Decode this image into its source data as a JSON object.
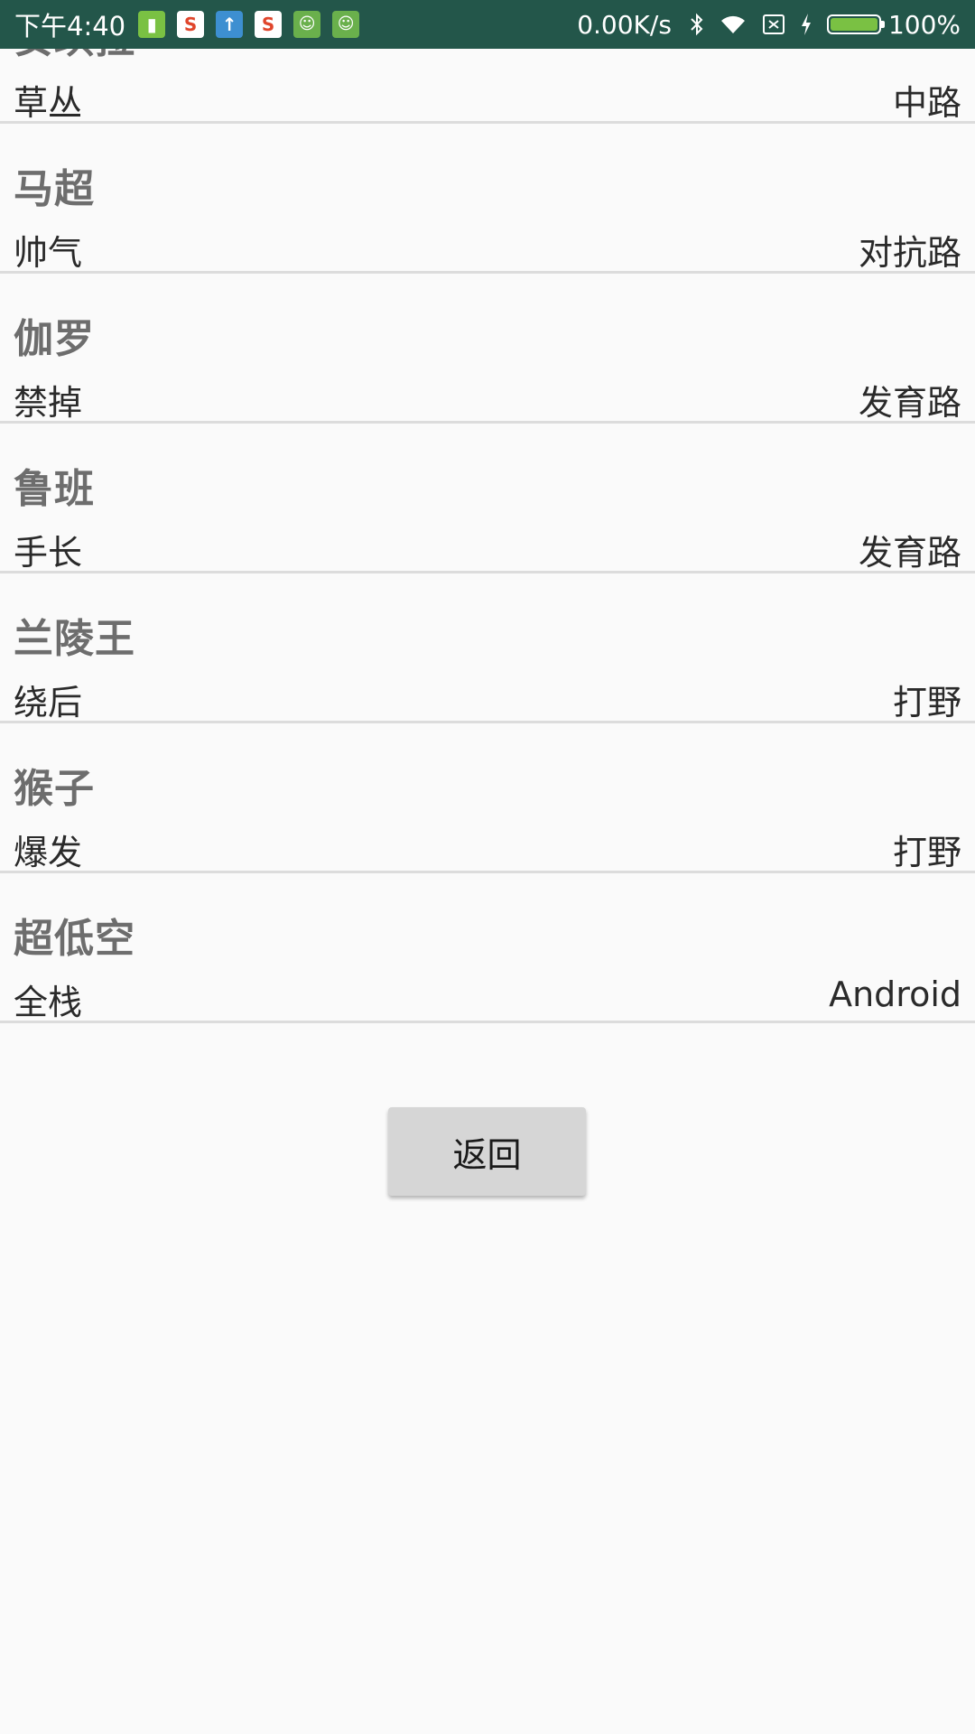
{
  "status_bar": {
    "time": "下午4:40",
    "speed": "0.00K/s",
    "battery": "100%",
    "icons": [
      "battery-app-icon",
      "sogou-icon",
      "upload-icon",
      "sogou-icon",
      "android-icon",
      "android-icon",
      "bluetooth-icon",
      "wifi-icon",
      "no-sim-icon",
      "charging-icon",
      "battery-icon"
    ]
  },
  "list": {
    "items": [
      {
        "name": "安琪拉",
        "tag": "草丛",
        "lane": "中路"
      },
      {
        "name": "马超",
        "tag": "帅气",
        "lane": "对抗路"
      },
      {
        "name": "伽罗",
        "tag": "禁掉",
        "lane": "发育路"
      },
      {
        "name": "鲁班",
        "tag": "手长",
        "lane": "发育路"
      },
      {
        "name": "兰陵王",
        "tag": "绕后",
        "lane": "打野"
      },
      {
        "name": "猴子",
        "tag": "爆发",
        "lane": "打野"
      },
      {
        "name": "超低空",
        "tag": "全栈",
        "lane": "Android"
      }
    ]
  },
  "back_button": {
    "label": "返回"
  }
}
